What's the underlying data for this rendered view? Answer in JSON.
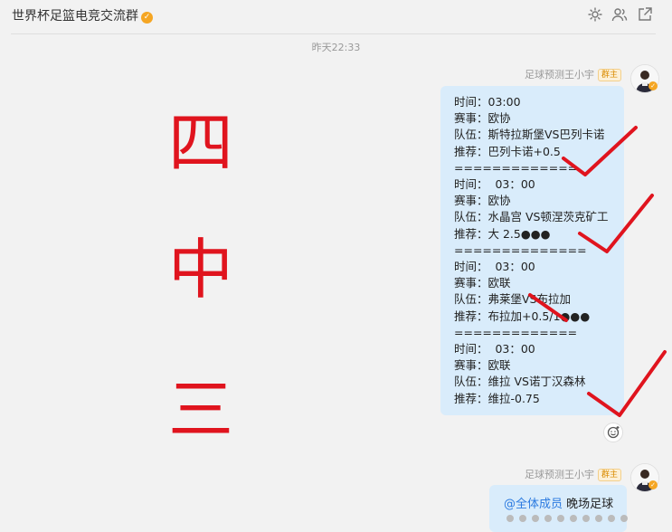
{
  "header": {
    "title": "世界杯足篮电竞交流群",
    "icons": [
      "gear-icon",
      "group-members-icon",
      "external-link-icon"
    ]
  },
  "timestamp": "昨天22:33",
  "messages": [
    {
      "sender": "足球预测王小宇",
      "badge": "群主",
      "lines": [
        "时间：03:00",
        "赛事：欧协",
        "队伍：斯特拉斯堡VS巴列卡诺",
        "推荐：巴列卡诺+0.5",
        "=============",
        "时间：  03：00",
        "赛事：欧协",
        "队伍：水晶宫 VS顿涅茨克矿工",
        "推荐：大 2.5●●●",
        "==============",
        "时间：  03：00",
        "赛事：欧联",
        "队伍：弗莱堡VS布拉加",
        "推荐：布拉加+0.5/1●●●",
        "=============",
        "时间：  03：00",
        "赛事：欧联",
        "队伍：维拉 VS诺丁汉森林",
        "推荐：维拉-0.75"
      ]
    },
    {
      "sender": "足球预测王小宇",
      "badge": "群主",
      "mention": "@全体成员",
      "text": " 晚场足球"
    }
  ],
  "overlay": {
    "big_chars": [
      "四",
      "中",
      "三"
    ],
    "marks": [
      "check",
      "check",
      "cross",
      "check"
    ],
    "mark_color": "#e0141e"
  },
  "colors": {
    "bubble": "#d9ecfb",
    "accent": "#e0141e",
    "badge": "#f5a623"
  }
}
